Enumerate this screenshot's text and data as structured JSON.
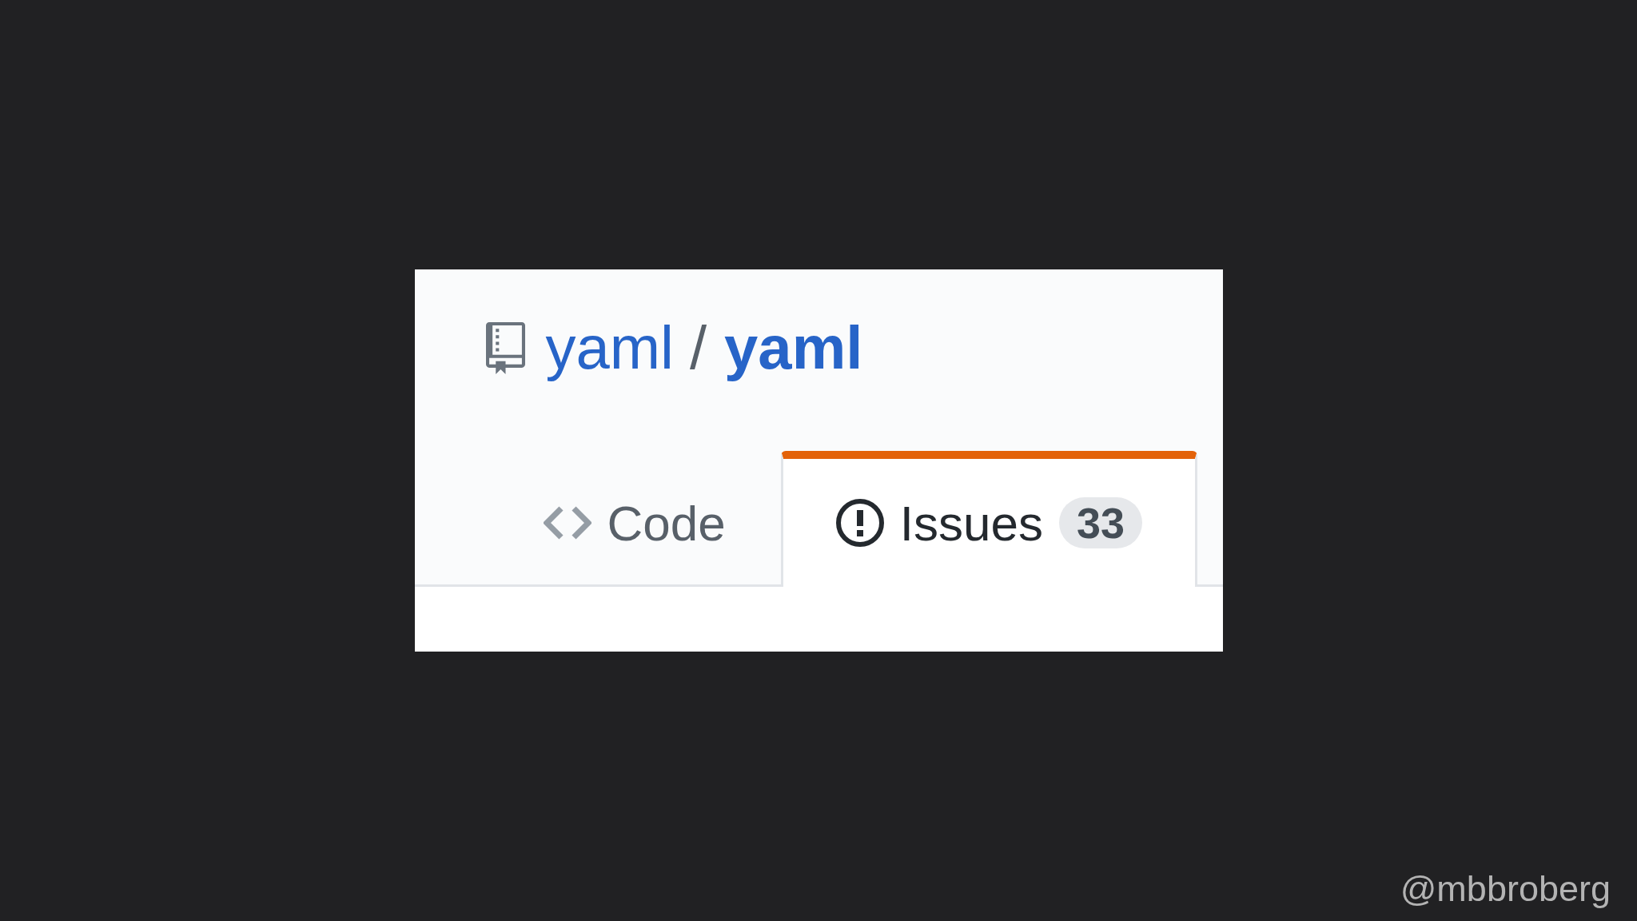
{
  "repo": {
    "owner": "yaml",
    "separator": "/",
    "name": "yaml"
  },
  "tabs": [
    {
      "kind": "code",
      "label": "Code",
      "selected": false
    },
    {
      "kind": "issues",
      "label": "Issues",
      "counter": "33",
      "selected": true
    }
  ],
  "credit": "@mbbroberg"
}
